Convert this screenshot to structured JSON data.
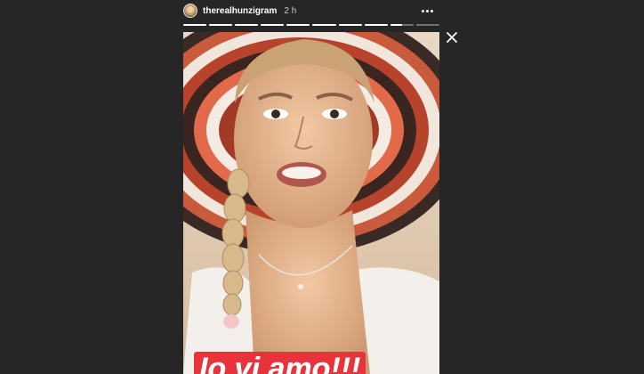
{
  "story": {
    "username": "therealhunzigram",
    "time_ago": "2 h",
    "more_icon": "more-horizontal-icon",
    "close_icon": "close-icon",
    "progress_segments": [
      1,
      1,
      1,
      1,
      1,
      1,
      1,
      1,
      0.5,
      0
    ],
    "caption": "Io vi amo!!!",
    "colors": {
      "background": "#262626",
      "caption_bg": "#e8333c"
    }
  }
}
